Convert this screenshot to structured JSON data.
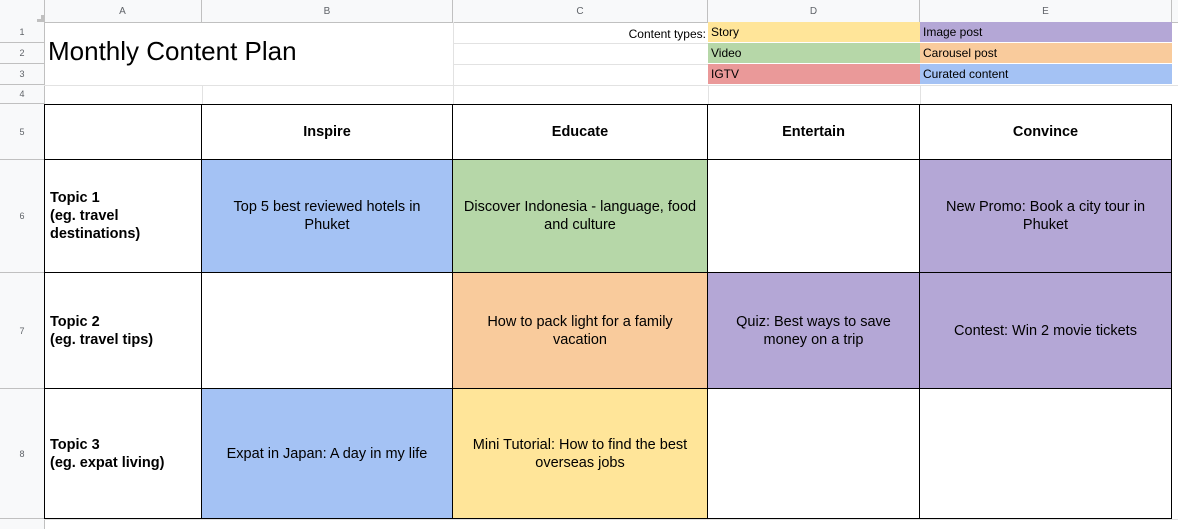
{
  "columns": [
    "A",
    "B",
    "C",
    "D",
    "E"
  ],
  "rows": [
    "1",
    "2",
    "3",
    "4",
    "5",
    "6",
    "7",
    "8"
  ],
  "title": "Monthly Content Plan",
  "legend": {
    "label": "Content types:",
    "items": [
      {
        "label": "Story",
        "color": "#ffe599"
      },
      {
        "label": "Image post",
        "color": "#b4a7d6"
      },
      {
        "label": "Video",
        "color": "#b6d7a8"
      },
      {
        "label": "Carousel post",
        "color": "#f9cb9c"
      },
      {
        "label": "IGTV",
        "color": "#ea9999"
      },
      {
        "label": "Curated content",
        "color": "#a4c2f4"
      }
    ]
  },
  "table": {
    "headers": [
      "Inspire",
      "Educate",
      "Entertain",
      "Convince"
    ],
    "rows": [
      {
        "topic_line1": "Topic 1",
        "topic_rest": "(eg. travel destinations)",
        "cells": [
          {
            "text": "Top 5 best reviewed hotels in Phuket",
            "color": "#a4c2f4"
          },
          {
            "text": "Discover Indonesia - language, food and culture",
            "color": "#b6d7a8"
          },
          {
            "text": "",
            "color": "#ffffff"
          },
          {
            "text": "New Promo: Book a city tour in Phuket",
            "color": "#b4a7d6"
          }
        ]
      },
      {
        "topic_line1": "Topic 2",
        "topic_rest": "(eg. travel tips)",
        "cells": [
          {
            "text": "",
            "color": "#ffffff"
          },
          {
            "text": "How to pack light for a family vacation",
            "color": "#f9cb9c"
          },
          {
            "text": "Quiz: Best ways to save money on a trip",
            "color": "#b4a7d6"
          },
          {
            "text": "Contest: Win 2 movie tickets",
            "color": "#b4a7d6"
          }
        ]
      },
      {
        "topic_line1": "Topic 3",
        "topic_rest": "(eg. expat living)",
        "cells": [
          {
            "text": "Expat in Japan: A day in my life",
            "color": "#a4c2f4"
          },
          {
            "text": "Mini Tutorial: How to find the best overseas jobs",
            "color": "#ffe599"
          },
          {
            "text": "",
            "color": "#ffffff"
          },
          {
            "text": "",
            "color": "#ffffff"
          }
        ]
      }
    ]
  }
}
